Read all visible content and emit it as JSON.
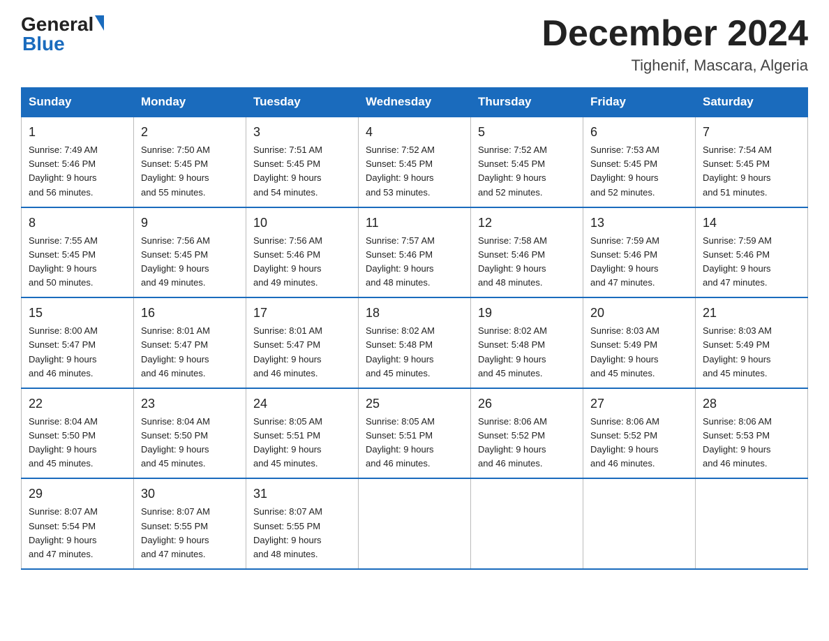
{
  "header": {
    "logo_text1": "General",
    "logo_text2": "Blue",
    "main_title": "December 2024",
    "subtitle": "Tighenif, Mascara, Algeria"
  },
  "weekdays": [
    "Sunday",
    "Monday",
    "Tuesday",
    "Wednesday",
    "Thursday",
    "Friday",
    "Saturday"
  ],
  "weeks": [
    [
      {
        "day": "1",
        "sunrise": "7:49 AM",
        "sunset": "5:46 PM",
        "daylight": "9 hours and 56 minutes."
      },
      {
        "day": "2",
        "sunrise": "7:50 AM",
        "sunset": "5:45 PM",
        "daylight": "9 hours and 55 minutes."
      },
      {
        "day": "3",
        "sunrise": "7:51 AM",
        "sunset": "5:45 PM",
        "daylight": "9 hours and 54 minutes."
      },
      {
        "day": "4",
        "sunrise": "7:52 AM",
        "sunset": "5:45 PM",
        "daylight": "9 hours and 53 minutes."
      },
      {
        "day": "5",
        "sunrise": "7:52 AM",
        "sunset": "5:45 PM",
        "daylight": "9 hours and 52 minutes."
      },
      {
        "day": "6",
        "sunrise": "7:53 AM",
        "sunset": "5:45 PM",
        "daylight": "9 hours and 52 minutes."
      },
      {
        "day": "7",
        "sunrise": "7:54 AM",
        "sunset": "5:45 PM",
        "daylight": "9 hours and 51 minutes."
      }
    ],
    [
      {
        "day": "8",
        "sunrise": "7:55 AM",
        "sunset": "5:45 PM",
        "daylight": "9 hours and 50 minutes."
      },
      {
        "day": "9",
        "sunrise": "7:56 AM",
        "sunset": "5:45 PM",
        "daylight": "9 hours and 49 minutes."
      },
      {
        "day": "10",
        "sunrise": "7:56 AM",
        "sunset": "5:46 PM",
        "daylight": "9 hours and 49 minutes."
      },
      {
        "day": "11",
        "sunrise": "7:57 AM",
        "sunset": "5:46 PM",
        "daylight": "9 hours and 48 minutes."
      },
      {
        "day": "12",
        "sunrise": "7:58 AM",
        "sunset": "5:46 PM",
        "daylight": "9 hours and 48 minutes."
      },
      {
        "day": "13",
        "sunrise": "7:59 AM",
        "sunset": "5:46 PM",
        "daylight": "9 hours and 47 minutes."
      },
      {
        "day": "14",
        "sunrise": "7:59 AM",
        "sunset": "5:46 PM",
        "daylight": "9 hours and 47 minutes."
      }
    ],
    [
      {
        "day": "15",
        "sunrise": "8:00 AM",
        "sunset": "5:47 PM",
        "daylight": "9 hours and 46 minutes."
      },
      {
        "day": "16",
        "sunrise": "8:01 AM",
        "sunset": "5:47 PM",
        "daylight": "9 hours and 46 minutes."
      },
      {
        "day": "17",
        "sunrise": "8:01 AM",
        "sunset": "5:47 PM",
        "daylight": "9 hours and 46 minutes."
      },
      {
        "day": "18",
        "sunrise": "8:02 AM",
        "sunset": "5:48 PM",
        "daylight": "9 hours and 45 minutes."
      },
      {
        "day": "19",
        "sunrise": "8:02 AM",
        "sunset": "5:48 PM",
        "daylight": "9 hours and 45 minutes."
      },
      {
        "day": "20",
        "sunrise": "8:03 AM",
        "sunset": "5:49 PM",
        "daylight": "9 hours and 45 minutes."
      },
      {
        "day": "21",
        "sunrise": "8:03 AM",
        "sunset": "5:49 PM",
        "daylight": "9 hours and 45 minutes."
      }
    ],
    [
      {
        "day": "22",
        "sunrise": "8:04 AM",
        "sunset": "5:50 PM",
        "daylight": "9 hours and 45 minutes."
      },
      {
        "day": "23",
        "sunrise": "8:04 AM",
        "sunset": "5:50 PM",
        "daylight": "9 hours and 45 minutes."
      },
      {
        "day": "24",
        "sunrise": "8:05 AM",
        "sunset": "5:51 PM",
        "daylight": "9 hours and 45 minutes."
      },
      {
        "day": "25",
        "sunrise": "8:05 AM",
        "sunset": "5:51 PM",
        "daylight": "9 hours and 46 minutes."
      },
      {
        "day": "26",
        "sunrise": "8:06 AM",
        "sunset": "5:52 PM",
        "daylight": "9 hours and 46 minutes."
      },
      {
        "day": "27",
        "sunrise": "8:06 AM",
        "sunset": "5:52 PM",
        "daylight": "9 hours and 46 minutes."
      },
      {
        "day": "28",
        "sunrise": "8:06 AM",
        "sunset": "5:53 PM",
        "daylight": "9 hours and 46 minutes."
      }
    ],
    [
      {
        "day": "29",
        "sunrise": "8:07 AM",
        "sunset": "5:54 PM",
        "daylight": "9 hours and 47 minutes."
      },
      {
        "day": "30",
        "sunrise": "8:07 AM",
        "sunset": "5:55 PM",
        "daylight": "9 hours and 47 minutes."
      },
      {
        "day": "31",
        "sunrise": "8:07 AM",
        "sunset": "5:55 PM",
        "daylight": "9 hours and 48 minutes."
      },
      null,
      null,
      null,
      null
    ]
  ],
  "labels": {
    "sunrise": "Sunrise:",
    "sunset": "Sunset:",
    "daylight": "Daylight:"
  }
}
